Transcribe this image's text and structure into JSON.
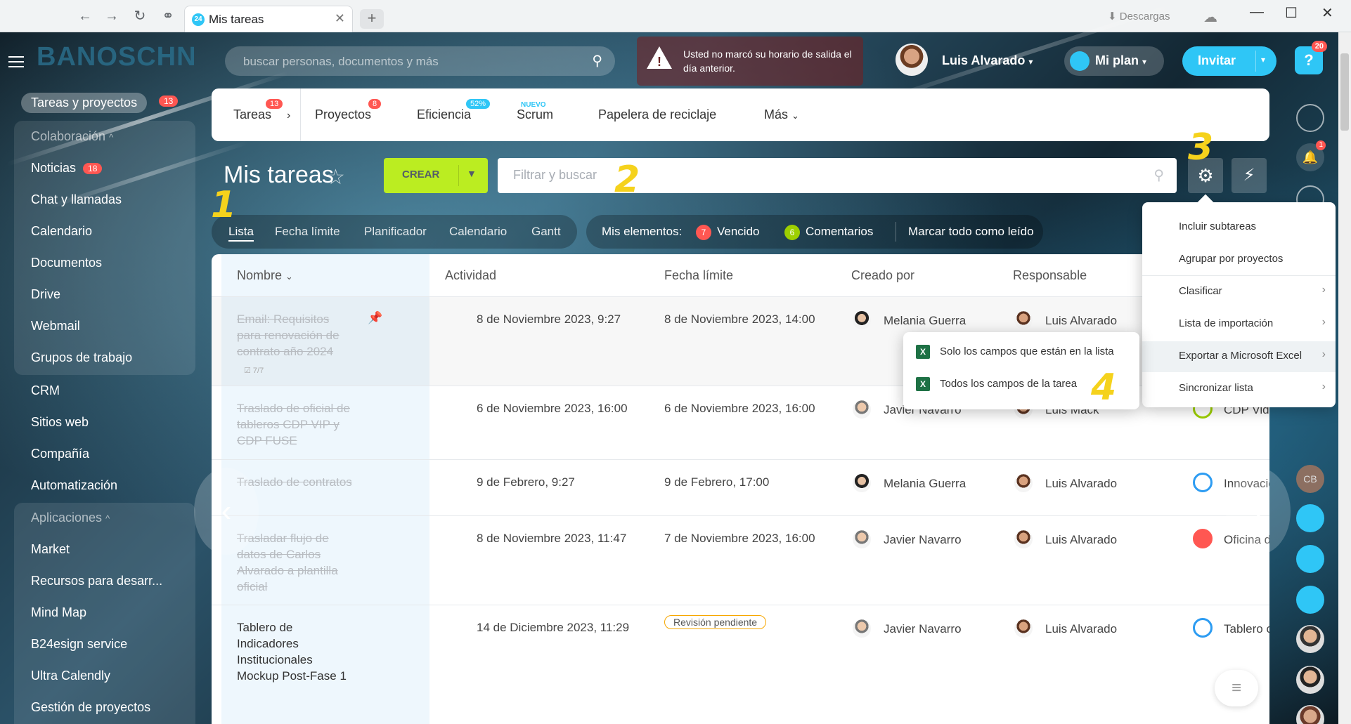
{
  "browser": {
    "tab_title": "Mis tareas",
    "tab_badge": "24",
    "downloads": "Descargas",
    "window_controls": [
      "—",
      "☐",
      "✕"
    ]
  },
  "header": {
    "logo": "BANOSCHN",
    "search_placeholder": "buscar personas, documentos y más",
    "warning_text": "Usted no marcó su horario de salida el día anterior.",
    "user_name": "Luis Alvarado",
    "plan_label": "Mi plan",
    "invite_label": "Invitar",
    "help_badge": "20"
  },
  "sidebar": {
    "active_label": "Tareas y proyectos",
    "active_count": "13",
    "collab_section": "Colaboración",
    "collab_items": [
      {
        "label": "Noticias",
        "count": "18"
      },
      {
        "label": "Chat y llamadas"
      },
      {
        "label": "Calendario"
      },
      {
        "label": "Documentos"
      },
      {
        "label": "Drive"
      },
      {
        "label": "Webmail"
      },
      {
        "label": "Grupos de trabajo"
      }
    ],
    "main_items": [
      "CRM",
      "Sitios web",
      "Compañía",
      "Automatización"
    ],
    "apps_section": "Aplicaciones",
    "apps_items": [
      "Market",
      "Recursos para desarr...",
      "Mind Map",
      "B24esign service",
      "Ultra Calendly",
      "Gestión de proyectos"
    ]
  },
  "topnav": {
    "items": [
      {
        "label": "Tareas",
        "badge": "13"
      },
      {
        "label": "Proyectos",
        "badge": "8"
      },
      {
        "label": "Eficiencia",
        "badge": "52%"
      },
      {
        "label": "Scrum",
        "badge": "NUEVO"
      },
      {
        "label": "Papelera de reciclaje"
      },
      {
        "label": "Más"
      }
    ]
  },
  "toolbar": {
    "page_title": "Mis tareas",
    "create_label": "CREAR",
    "filter_placeholder": "Filtrar y buscar"
  },
  "views": {
    "items": [
      "Lista",
      "Fecha límite",
      "Planificador",
      "Calendario",
      "Gantt"
    ],
    "active": "Lista"
  },
  "my_items": {
    "label": "Mis elementos:",
    "overdue_count": "7",
    "overdue_label": "Vencido",
    "comments_count": "6",
    "comments_label": "Comentarios",
    "mark_read": "Marcar todo como leído"
  },
  "table": {
    "columns": [
      "Nombre",
      "Actividad",
      "Fecha límite",
      "Creado por",
      "Responsable"
    ],
    "rows": [
      {
        "name": "Email: Requisitos para renovación de contrato año 2024",
        "done": true,
        "checklist": "7/7",
        "activity": "8 de Noviembre 2023, 9:27",
        "deadline": "8 de Noviembre 2023, 14:00",
        "creator": "Melania Guerra",
        "responsible": "Luis Alvarado",
        "project": ""
      },
      {
        "name": "Traslado de oficial de tableros CDP VIP y CDP FUSE",
        "done": true,
        "activity": "6 de Noviembre 2023, 16:00",
        "deadline": "6 de Noviembre 2023, 16:00",
        "creator": "Javier Navarro",
        "responsible": "Luis Mack",
        "project": "CDP Vida"
      },
      {
        "name": "Traslado de contratos",
        "done": true,
        "activity": "9 de Febrero, 9:27",
        "deadline": "9 de Febrero, 17:00",
        "creator": "Melania Guerra",
        "responsible": "Luis Alvarado",
        "project": "Innovación"
      },
      {
        "name": "Trasladar flujo de datos de Carlos Alvarado a plantilla oficial",
        "done": true,
        "activity": "8 de Noviembre 2023, 11:47",
        "deadline": "7 de Noviembre 2023, 16:00",
        "creator": "Javier Navarro",
        "responsible": "Luis Alvarado",
        "project": "Oficina d"
      },
      {
        "name": "Tablero de Indicadores Institucionales Mockup Post-Fase 1",
        "done": false,
        "activity": "14 de Diciembre 2023, 11:29",
        "deadline": "Revisión pendiente",
        "creator": "Javier Navarro",
        "responsible": "Luis Alvarado",
        "project": "Tablero c"
      }
    ]
  },
  "settings_menu": {
    "items": [
      {
        "label": "Incluir subtareas",
        "arrow": false
      },
      {
        "label": "Agrupar por proyectos",
        "arrow": false
      },
      {
        "label": "Clasificar",
        "arrow": true
      },
      {
        "label": "Lista de importación",
        "arrow": true
      },
      {
        "label": "Exportar a Microsoft Excel",
        "arrow": true
      },
      {
        "label": "Sincronizar lista",
        "arrow": true
      }
    ]
  },
  "export_submenu": {
    "items": [
      "Solo los campos que están en la lista",
      "Todos los campos de la tarea"
    ]
  },
  "right_panel": {
    "bell_badge": "1",
    "initials": "CB"
  },
  "annotations": [
    "1",
    "2",
    "3",
    "4"
  ],
  "colors": {
    "accent": "#2fc6f6",
    "create": "#bbed21",
    "danger": "#ff5752",
    "overdue": "#ff5752",
    "comments": "#9dcf00"
  }
}
